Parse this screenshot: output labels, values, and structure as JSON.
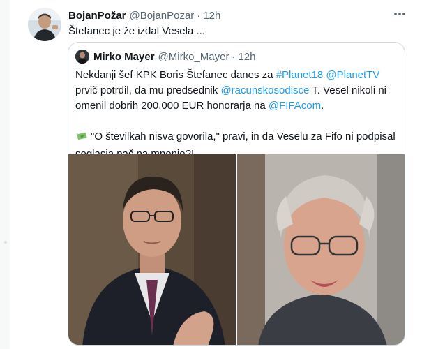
{
  "tweet": {
    "author_name": "BojanPožar",
    "author_handle": "@BojanPozar",
    "separator": "·",
    "time": "12h",
    "text": "Štefanec je že izdal Vesela ..."
  },
  "quote": {
    "author_name": "Mirko Mayer",
    "author_handle": "@Mirko_Mayer",
    "separator": "·",
    "time": "12h",
    "paragraph1": [
      {
        "text": "Nekdanji šef KPK Boris Štefanec danes za ",
        "link": false
      },
      {
        "text": "#Planet18",
        "link": true
      },
      {
        "text": " ",
        "link": false
      },
      {
        "text": "@PlanetTV",
        "link": true
      },
      {
        "text": " prvič potrdil, da mu predsednik ",
        "link": false
      },
      {
        "text": "@racunskosodisce",
        "link": true
      },
      {
        "text": " T. Vesel nikoli ni omenil dobrih 200.000 EUR honorarja na ",
        "link": false
      },
      {
        "text": "@FIFAcom",
        "link": true
      },
      {
        "text": ".",
        "link": false
      }
    ],
    "paragraph2": "\"O številkah nisva govorila,\" pravi, in da Veselu za Fifo ni podpisal soglasja pač pa mnenje?!",
    "emoji_icon": "money-with-wings-icon"
  },
  "colors": {
    "link": "#1d9bf0",
    "text": "#0f1419",
    "secondary": "#536471",
    "border": "#cfd9de"
  }
}
